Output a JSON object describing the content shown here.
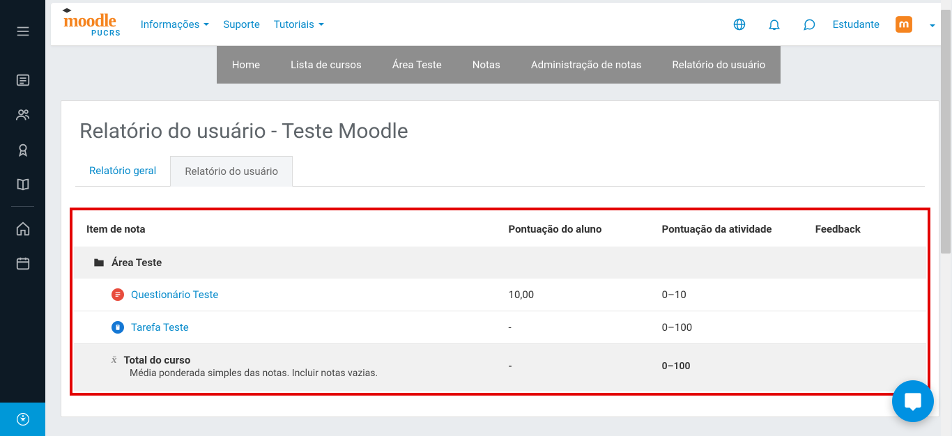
{
  "topnav": {
    "items": [
      "Informações",
      "Suporte",
      "Tutoriais"
    ]
  },
  "user": {
    "label": "Estudante"
  },
  "course_tabs": [
    "Home",
    "Lista de cursos",
    "Área Teste",
    "Notas",
    "Administração de notas",
    "Relatório do usuário"
  ],
  "page_title": "Relatório do usuário - Teste Moodle",
  "inner_tabs": {
    "general": "Relatório geral",
    "user": "Relatório do usuário"
  },
  "table": {
    "headers": {
      "item": "Item de nota",
      "score": "Pontuação do aluno",
      "range": "Pontuação da atividade",
      "feedback": "Feedback"
    },
    "category": "Área Teste",
    "rows": [
      {
        "type": "quiz",
        "name": "Questionário Teste",
        "score": "10,00",
        "range": "0–10",
        "feedback": ""
      },
      {
        "type": "assign",
        "name": "Tarefa Teste",
        "score": "-",
        "range": "0–100",
        "feedback": ""
      }
    ],
    "total": {
      "name": "Total do curso",
      "desc": "Média ponderada simples das notas. Incluir notas vazias.",
      "score": "-",
      "range": "0–100",
      "feedback": ""
    }
  }
}
